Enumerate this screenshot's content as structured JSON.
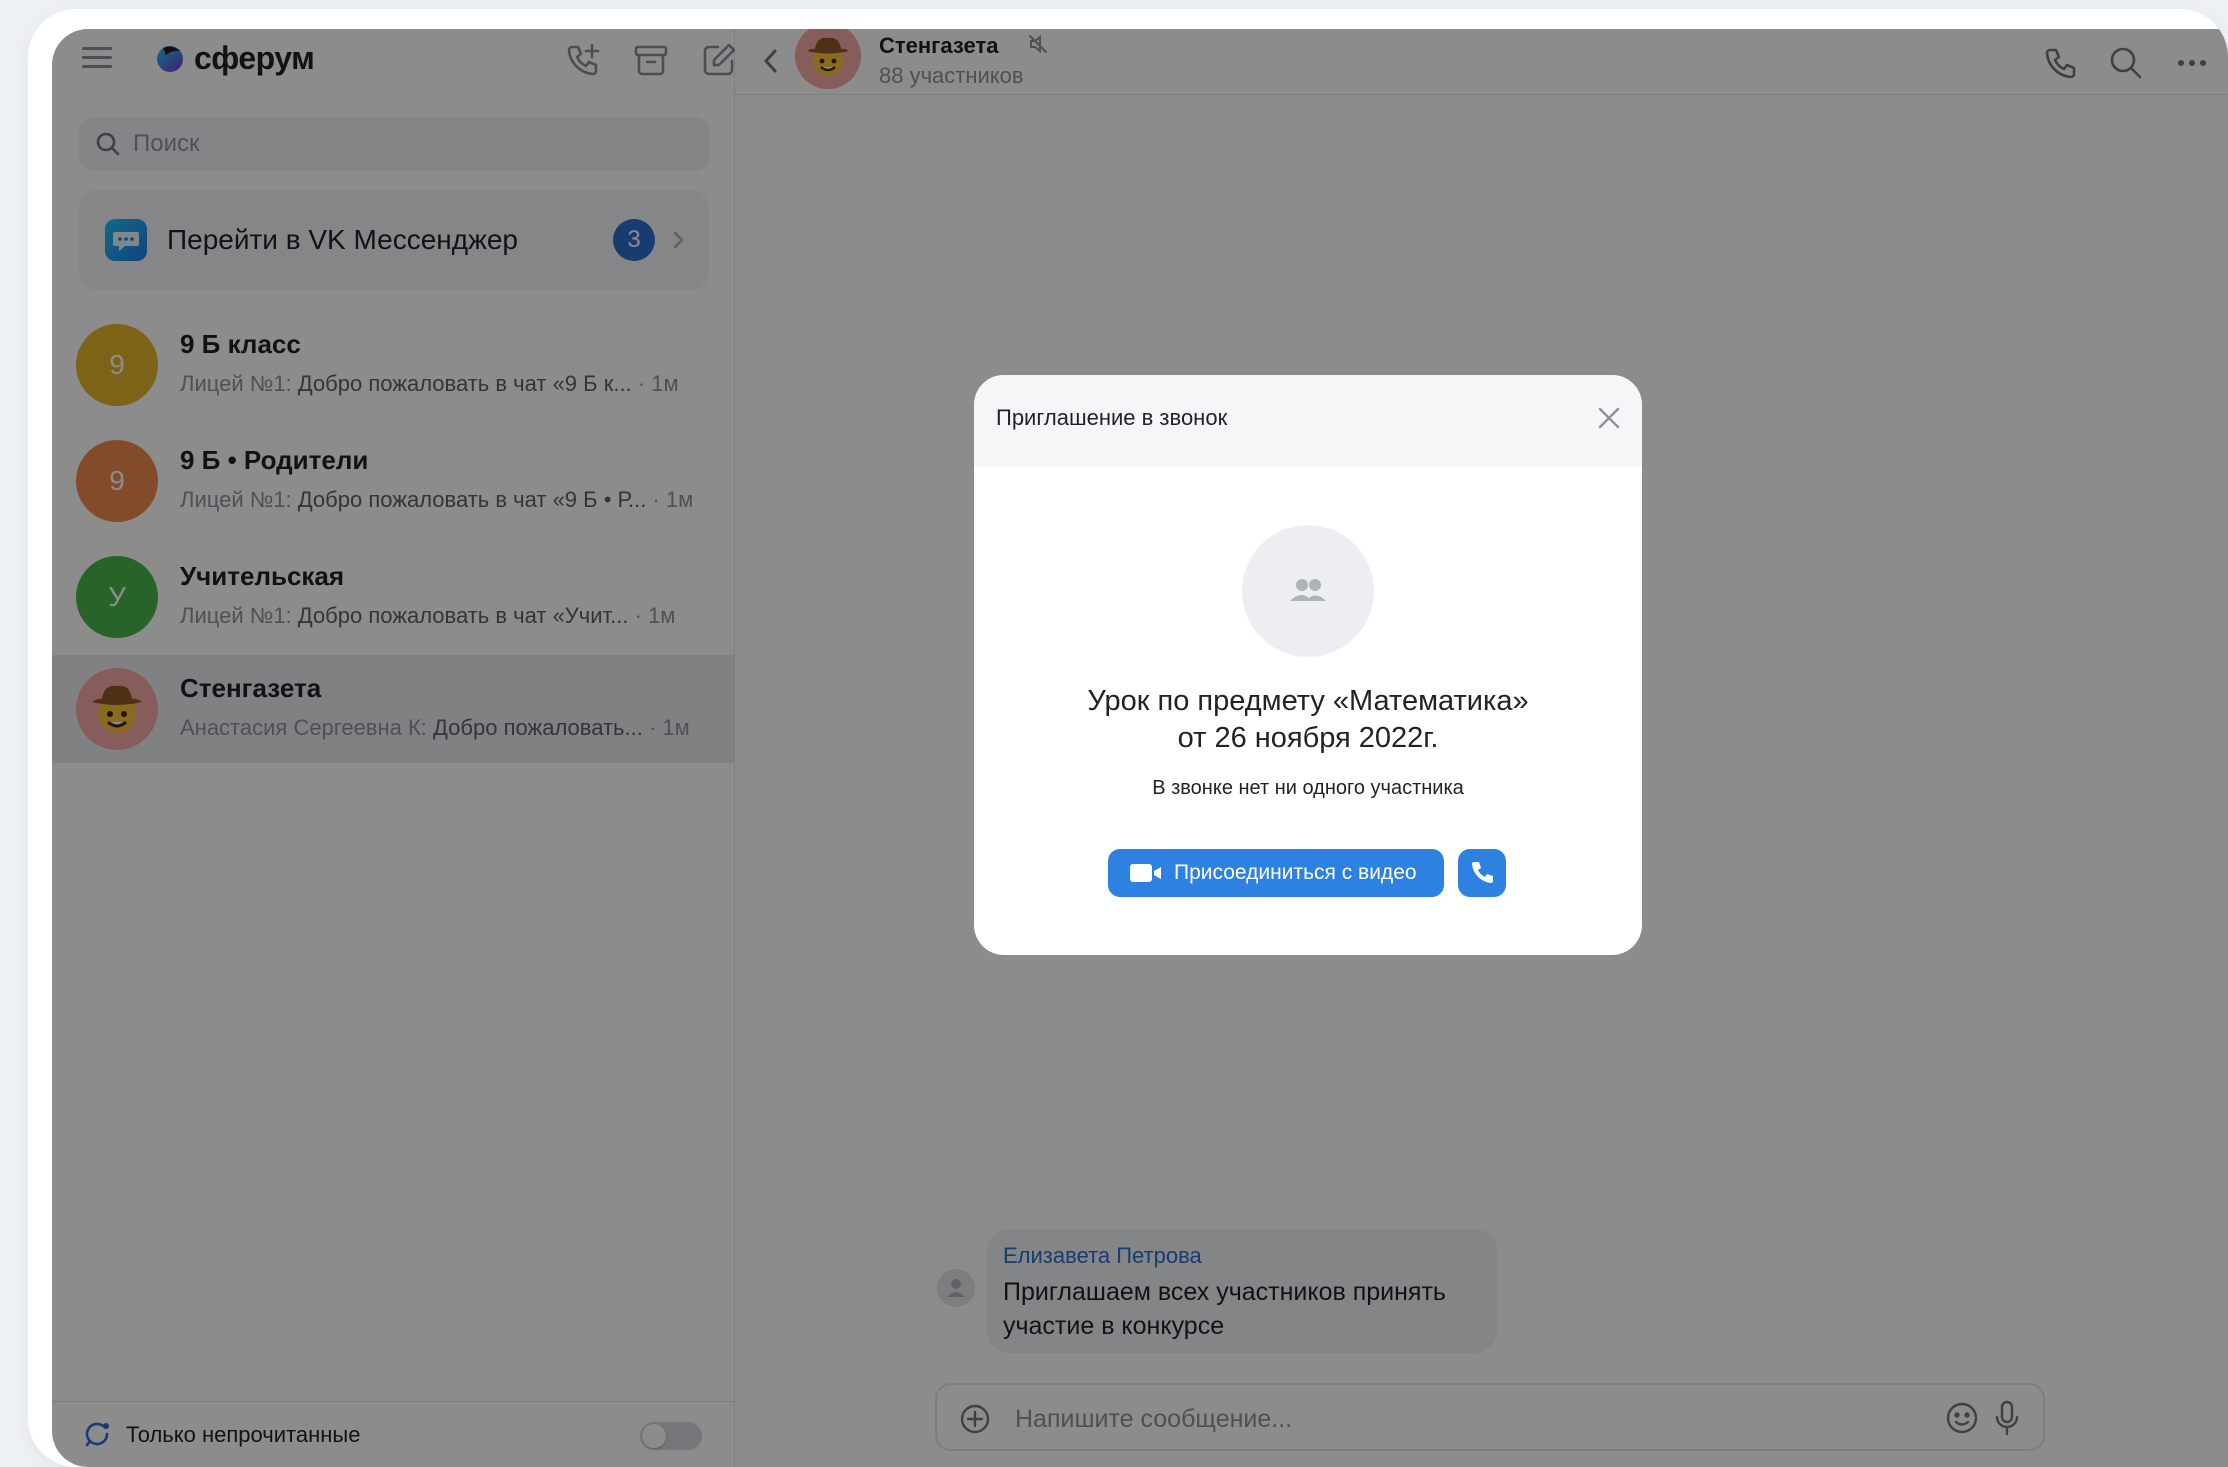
{
  "app": {
    "logo_text": "сферум"
  },
  "sidebar": {
    "search_placeholder": "Поиск",
    "vk_banner": {
      "label": "Перейти в VK Мессенджер",
      "badge": "3"
    },
    "chats": [
      {
        "title": "9 Б класс",
        "avatar_letter": "9",
        "avatar_color": "#e4b42b",
        "author": "Лицей №1:",
        "message": " Добро пожаловать в чат «9 Б к...",
        "time": " · 1м"
      },
      {
        "title": "9 Б • Родители",
        "avatar_letter": "9",
        "avatar_color": "#ef8a4c",
        "author": "Лицей №1:",
        "message": " Добро пожаловать в чат «9 Б • Р...",
        "time": " · 1м"
      },
      {
        "title": "Учительская",
        "avatar_letter": "У",
        "avatar_color": "#49b547",
        "author": "Лицей №1:",
        "message": " Добро пожаловать в чат «Учит...",
        "time": " · 1м"
      },
      {
        "title": "Стенгазета",
        "avatar_letter": "",
        "avatar_color": "#f5a9a4",
        "author": "Анастасия Сергеевна К:",
        "message": " Добро пожаловать...",
        "time": " · 1м"
      }
    ],
    "footer_label": "Только непрочитанные"
  },
  "chat_header": {
    "title": "Стенгазета",
    "subtitle": "88 участников"
  },
  "message": {
    "author": "Елизавета Петрова",
    "text": "Приглашаем всех участников принять участие в конкурсе"
  },
  "composer": {
    "placeholder": "Напишите сообщение..."
  },
  "modal": {
    "title": "Приглашение в звонок",
    "heading_line1": "Урок по предмету «Математика»",
    "heading_line2": "от 26 ноября 2022г.",
    "subtitle": "В звонке нет ни одного участника",
    "join_label": "Присоединиться с видео"
  },
  "colors": {
    "accent": "#2d81e0",
    "badge": "#2d6cd0"
  },
  "icons": [
    "menu-icon",
    "add-call-icon",
    "archive-icon",
    "compose-icon",
    "search-icon",
    "chevron-right-icon",
    "back-icon",
    "mute-icon",
    "phone-icon",
    "more-icon",
    "plus-icon",
    "emoji-icon",
    "mic-icon",
    "close-icon",
    "group-icon",
    "video-icon",
    "unread-icon"
  ]
}
